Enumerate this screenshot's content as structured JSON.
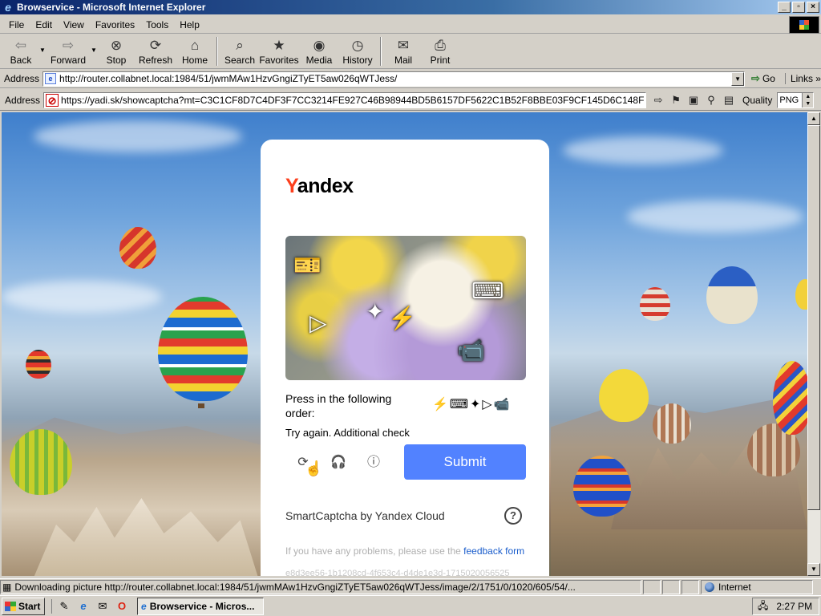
{
  "window": {
    "title": "Browservice - Microsoft Internet Explorer"
  },
  "menu": [
    "File",
    "Edit",
    "View",
    "Favorites",
    "Tools",
    "Help"
  ],
  "toolbar": [
    {
      "label": "Back",
      "icon": "back-arrow-icon",
      "glyph": "⇦"
    },
    {
      "label": "Forward",
      "icon": "forward-arrow-icon",
      "glyph": "⇨"
    },
    {
      "label": "Stop",
      "icon": "stop-icon",
      "glyph": "⊗"
    },
    {
      "label": "Refresh",
      "icon": "refresh-icon",
      "glyph": "⟳"
    },
    {
      "label": "Home",
      "icon": "home-icon",
      "glyph": "⌂"
    },
    {
      "label": "Search",
      "icon": "search-icon",
      "glyph": "⌕"
    },
    {
      "label": "Favorites",
      "icon": "favorites-icon",
      "glyph": "★"
    },
    {
      "label": "Media",
      "icon": "media-icon",
      "glyph": "◉"
    },
    {
      "label": "History",
      "icon": "history-icon",
      "glyph": "◷"
    },
    {
      "label": "Mail",
      "icon": "mail-icon",
      "glyph": "✉"
    },
    {
      "label": "Print",
      "icon": "print-icon",
      "glyph": "⎙"
    }
  ],
  "address": {
    "label": "Address",
    "url": "http://router.collabnet.local:1984/51/jwmMAw1HzvGngiZTyET5aw026qWTJess/",
    "go_label": "Go",
    "links_label": "Links"
  },
  "plugin_bar": {
    "label": "Address",
    "url": "https://yadi.sk/showcaptcha?mt=C3C1CF8D7C4DF3F7CC3214FE927C46B98944BD5B6157DF5622C1B52F8BBE03F9CF145D6C148F",
    "quality_label": "Quality",
    "quality_value": "PNG"
  },
  "captcha": {
    "brand_first": "Y",
    "brand_rest": "andex",
    "instruction": "Press in the following order:",
    "sequence": [
      "⚡",
      "⌨",
      "✦",
      "▷",
      "📹"
    ],
    "error": "Try again. Additional check",
    "submit_label": "Submit",
    "footer_brand": "SmartCaptcha by Yandex Cloud",
    "help_glyph": "?",
    "problems_text": "If you have any problems, please use the ",
    "feedback_link": "feedback form",
    "request_id": "e8d3ee56-1b1208cd-4f653c4-d4de1e3d-1715020056525",
    "accent": "#5282ff",
    "brand_color": "#fc3f1d"
  },
  "status": {
    "text": "Downloading picture http://router.collabnet.local:1984/51/jwmMAw1HzvGngiZTyET5aw026qWTJess/image/2/1751/0/1020/605/54/...",
    "zone": "Internet"
  },
  "taskbar": {
    "start_label": "Start",
    "task_label": "Browservice - Micros...",
    "clock": "2:27 PM"
  }
}
